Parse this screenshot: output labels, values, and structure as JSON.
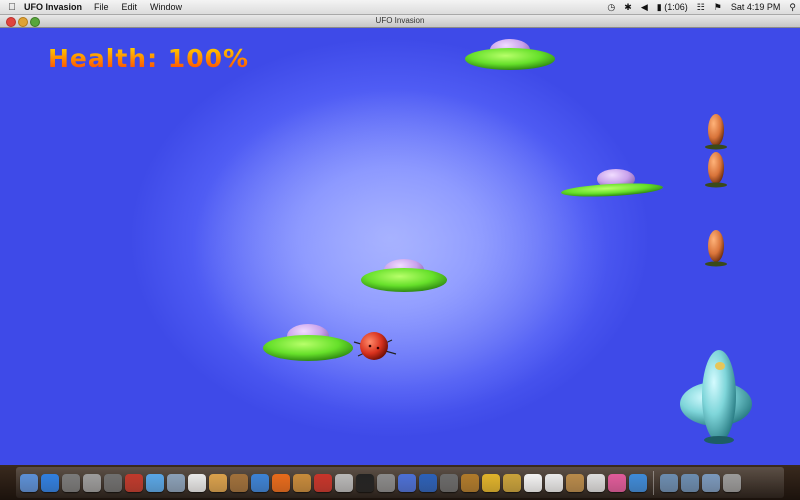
{
  "menubar": {
    "app_name": "UFO Invasion",
    "menus": [
      "File",
      "Edit",
      "Window"
    ],
    "status": {
      "battery": "(1:06)",
      "clock": "Sat 4:19 PM"
    }
  },
  "window": {
    "title": "UFO Invasion"
  },
  "hud": {
    "health_label": "Health:",
    "health_value": "100%"
  },
  "colors": {
    "sky_center": "#9aa6ff",
    "sky_edge": "#3e4ae8",
    "ufo_saucer": "#66e02a",
    "ufo_dome": "#c9a2ec",
    "missile": "#d9743a",
    "player_ship": "#7fd6da",
    "enemy_bomb": "#d8321e"
  },
  "dock": {
    "icons": [
      "finder-icon",
      "app-store-icon",
      "time-machine-icon",
      "screenshot-icon",
      "system-prefs-icon",
      "photo-booth-icon",
      "ichat-icon",
      "preview-icon",
      "calendar-icon",
      "photos-icon",
      "address-book-icon",
      "safari-icon",
      "firefox-icon",
      "iphoto-icon",
      "imovie-icon",
      "photo-icon",
      "terminal-icon",
      "tools-icon",
      "itunes-icon",
      "pen-icon",
      "music-icon",
      "guitar-icon",
      "chrome-icon",
      "dvd-icon",
      "textedit-icon",
      "pages-icon",
      "utility-icon",
      "x11-icon",
      "paint-icon",
      "ufo-invasion-icon",
      "folder-icon",
      "folder-icon-2",
      "documents-icon",
      "trash-icon"
    ]
  }
}
